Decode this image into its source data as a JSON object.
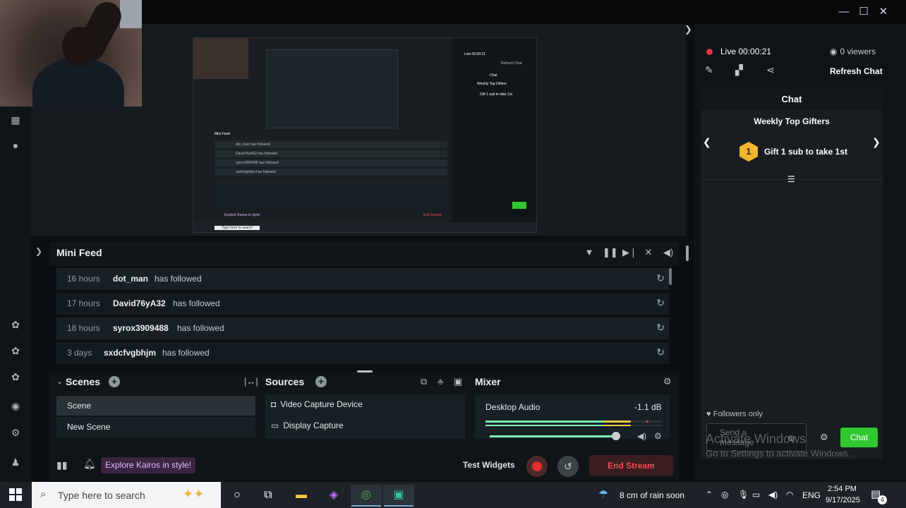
{
  "window": {
    "minimize": "—",
    "maximize": "☐",
    "close": "✕"
  },
  "mini_feed": {
    "title": "Mini Feed",
    "rows": [
      {
        "time": "16 hours",
        "name": "dot_man",
        "action": "has followed"
      },
      {
        "time": "17 hours",
        "name": "David76yA32",
        "action": "has followed"
      },
      {
        "time": "18 hours",
        "name": "syrox3909488",
        "action": "has followed"
      },
      {
        "time": "3 days",
        "name": "sxdcfvgbhjm",
        "action": "has followed"
      }
    ]
  },
  "scenes": {
    "title": "Scenes",
    "items": [
      "Scene",
      "New Scene"
    ]
  },
  "sources": {
    "title": "Sources",
    "items": [
      "Video Capture Device",
      "Display Capture"
    ]
  },
  "mixer": {
    "title": "Mixer",
    "channel": "Desktop Audio",
    "level": "-1.1 dB"
  },
  "footer": {
    "explore": "Explore Kairos in style!",
    "test_widgets": "Test Widgets",
    "end_stream": "End Stream"
  },
  "chat_panel": {
    "live": "Live 00:00:21",
    "viewers": "0 viewers",
    "refresh": "Refresh Chat",
    "chat_title": "Chat",
    "top_gifters": "Weekly Top Gifters",
    "gift_rank": "1",
    "gift_text": "Gift 1 sub to take 1st",
    "followers_only": "Followers only",
    "send_placeholder": "Send a message",
    "chat_button": "Chat",
    "watermark_title": "Activate Windows",
    "watermark_sub": "Go to Settings to activate Windows."
  },
  "preview": {
    "feed_rows": [
      "dot_man has followed",
      "David76yA32 has followed",
      "syrox3909488 has followed",
      "sxdcfvgbhjm has followed"
    ],
    "mini_title": "Mini Feed",
    "chat_title": "Chat",
    "top_gifters": "Weekly Top Gifters",
    "gift_text": "Gift 1 sub to take 1st",
    "refresh": "Refresh Chat",
    "live": "Live 00:00:21",
    "search": "Type here to search",
    "explore": "Explore Kairos in style!",
    "end": "End Stream"
  },
  "taskbar": {
    "search": "Type here to search",
    "weather": "8 cm of rain soon",
    "lang": "ENG",
    "time": "2:54 PM",
    "date": "9/17/2025",
    "notifications": "4"
  },
  "colors": {
    "accent_green": "#31c82f",
    "live_red": "#e2353a",
    "end_red": "#ef4b55",
    "mixer_green": "#7ef2b0",
    "mixer_yellow": "#f2c744"
  }
}
